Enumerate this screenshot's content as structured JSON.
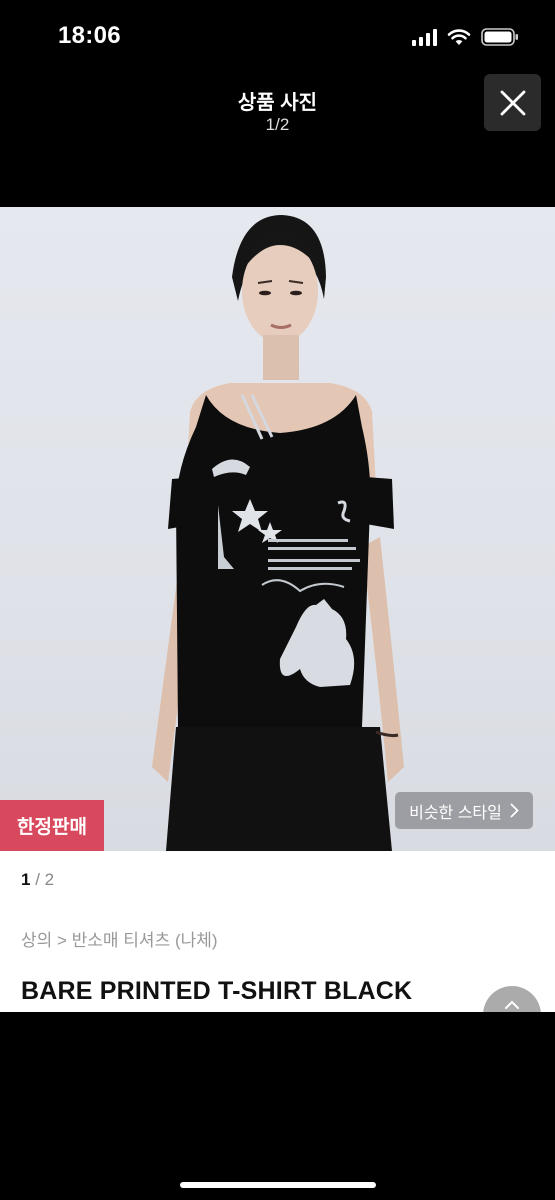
{
  "status_bar": {
    "time": "18:06"
  },
  "header": {
    "title": "상품 사진",
    "counter": "1/2"
  },
  "photo": {
    "badge": "한정판매",
    "similar_style_label": "비슷한 스타일"
  },
  "info": {
    "pager_current": "1",
    "pager_total": " / 2",
    "breadcrumb": "상의 > 반소매 티셔츠 (나체)",
    "product_name": "BARE PRINTED T-SHIRT BLACK"
  },
  "colors": {
    "badge": "#d9495e",
    "background": "#000000"
  },
  "icons": [
    "signal-icon",
    "wifi-icon",
    "battery-icon",
    "close-icon",
    "chevron-right-icon",
    "chevron-up-icon"
  ]
}
